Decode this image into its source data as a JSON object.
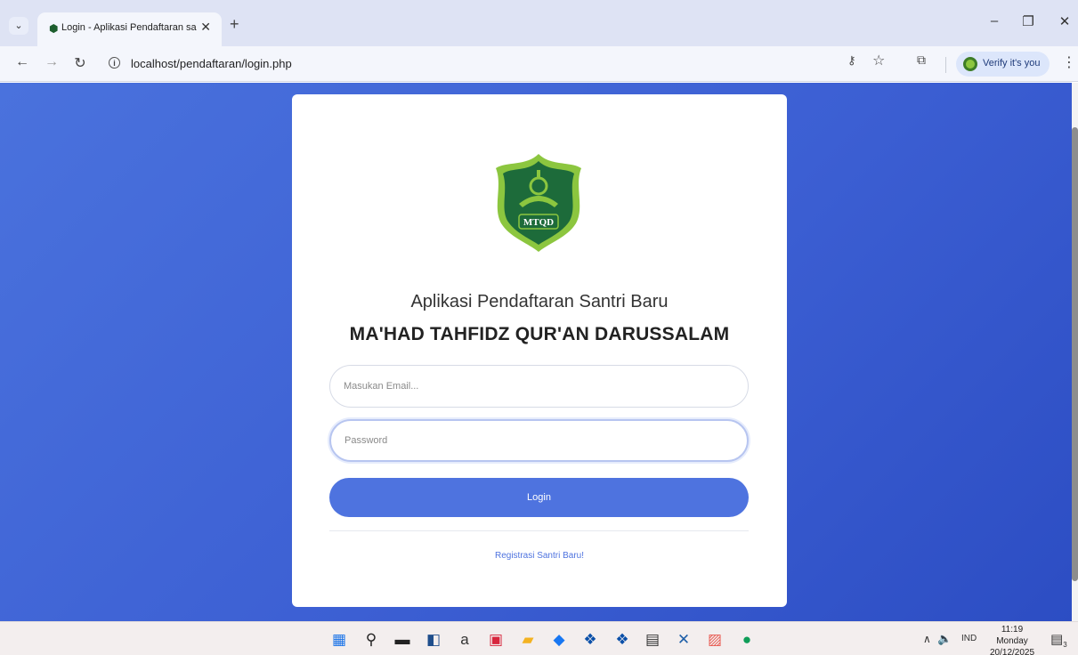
{
  "browser": {
    "tab_title": "Login - Aplikasi Pendaftaran sa",
    "tab_close": "✕",
    "new_tab": "+",
    "url": "localhost/pendaftaran/login.php",
    "verify_label": "Verify it's you",
    "icons": [
      "tab-menu-icon",
      "favicon-icon",
      "back-icon",
      "forward-icon",
      "reload-icon",
      "info-icon",
      "key-icon",
      "star-icon",
      "extensions-icon",
      "profile-icon",
      "menu-icon"
    ]
  },
  "window": {
    "minimize": "–",
    "maximize": "❐",
    "close": "✕"
  },
  "login": {
    "logo_text": "MTQD",
    "subtitle": "Aplikasi Pendaftaran Santri Baru",
    "title": "MA'HAD TAHFIDZ QUR'AN DARUSSALAM",
    "email_placeholder": "Masukan Email...",
    "password_placeholder": "Password",
    "login_label": "Login",
    "register_label": "Registrasi Santri Baru!"
  },
  "taskbar": {
    "lang": "IND",
    "time": "11:19",
    "day": "Monday",
    "date": "20/12/2025",
    "notif_count": "3",
    "apps": [
      "windows-start-icon",
      "search-icon",
      "task-view-icon",
      "widgets-icon",
      "amazon-icon",
      "wps-icon",
      "file-explorer-icon",
      "store-icon",
      "dropbox-icon",
      "briefcase-icon",
      "xampp-icon",
      "calendar-app-icon",
      "chrome-icon"
    ]
  },
  "colors": {
    "accent": "#4e73df",
    "page_bg": "#3c5fd3",
    "logo_green": "#1d6b3a",
    "logo_light": "#8cc63f"
  }
}
